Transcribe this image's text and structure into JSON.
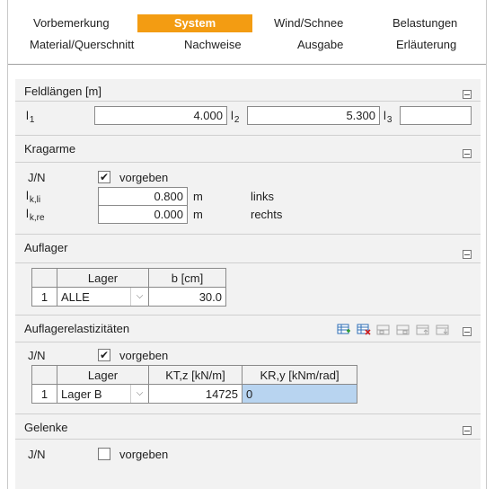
{
  "tabs": [
    {
      "label": "Vorbemerkung",
      "active": false
    },
    {
      "label": "System",
      "active": true
    },
    {
      "label": "Wind/Schnee",
      "active": false
    },
    {
      "label": "Belastungen",
      "active": false
    },
    {
      "label": "Material/Querschnitt",
      "active": false
    },
    {
      "label": "Nachweise",
      "active": false
    },
    {
      "label": "Ausgabe",
      "active": false
    },
    {
      "label": "Erläuterung",
      "active": false
    }
  ],
  "feldlaengen": {
    "title": "Feldlängen [m]",
    "l1_label": "l",
    "l1_sub": "1",
    "l1_value": "4.000",
    "l2_label": "l",
    "l2_sub": "2",
    "l2_value": "5.300",
    "l3_label": "l",
    "l3_sub": "3",
    "l3_value": ""
  },
  "kragarme": {
    "title": "Kragarme",
    "jn_label": "J/N",
    "check_label": "vorgeben",
    "checked": "✔",
    "lkli_label": "l",
    "lkli_sub": "k,li",
    "lkli_value": "0.800",
    "lkli_unit": "m",
    "lkli_desc": "links",
    "lkre_label": "l",
    "lkre_sub": "k,re",
    "lkre_value": "0.000",
    "lkre_unit": "m",
    "lkre_desc": "rechts"
  },
  "auflager": {
    "title": "Auflager",
    "col_lager": "Lager",
    "col_b": "b [cm]",
    "rows": [
      {
        "num": "1",
        "lager": "ALLE",
        "b": "30.0"
      }
    ]
  },
  "auflagerelast": {
    "title": "Auflagerelastizitäten",
    "jn_label": "J/N",
    "check_label": "vorgeben",
    "checked": "✔",
    "col_lager": "Lager",
    "col_kt": "KT,z [kN/m]",
    "col_kr": "KR,y [kNm/rad]",
    "rows": [
      {
        "num": "1",
        "lager": "Lager B",
        "kt": "14725",
        "kr": "0"
      }
    ],
    "toolbar_icons": [
      "add-row-icon",
      "delete-row-icon",
      "insert-row-icon",
      "copy-row-icon",
      "move-up-icon",
      "move-down-icon"
    ]
  },
  "gelenke": {
    "title": "Gelenke",
    "jn_label": "J/N",
    "check_label": "vorgeben",
    "checked": ""
  },
  "colors": {
    "accent": "#f39c12",
    "selection": "#b8d4f0",
    "panel": "#f2f2f2"
  }
}
